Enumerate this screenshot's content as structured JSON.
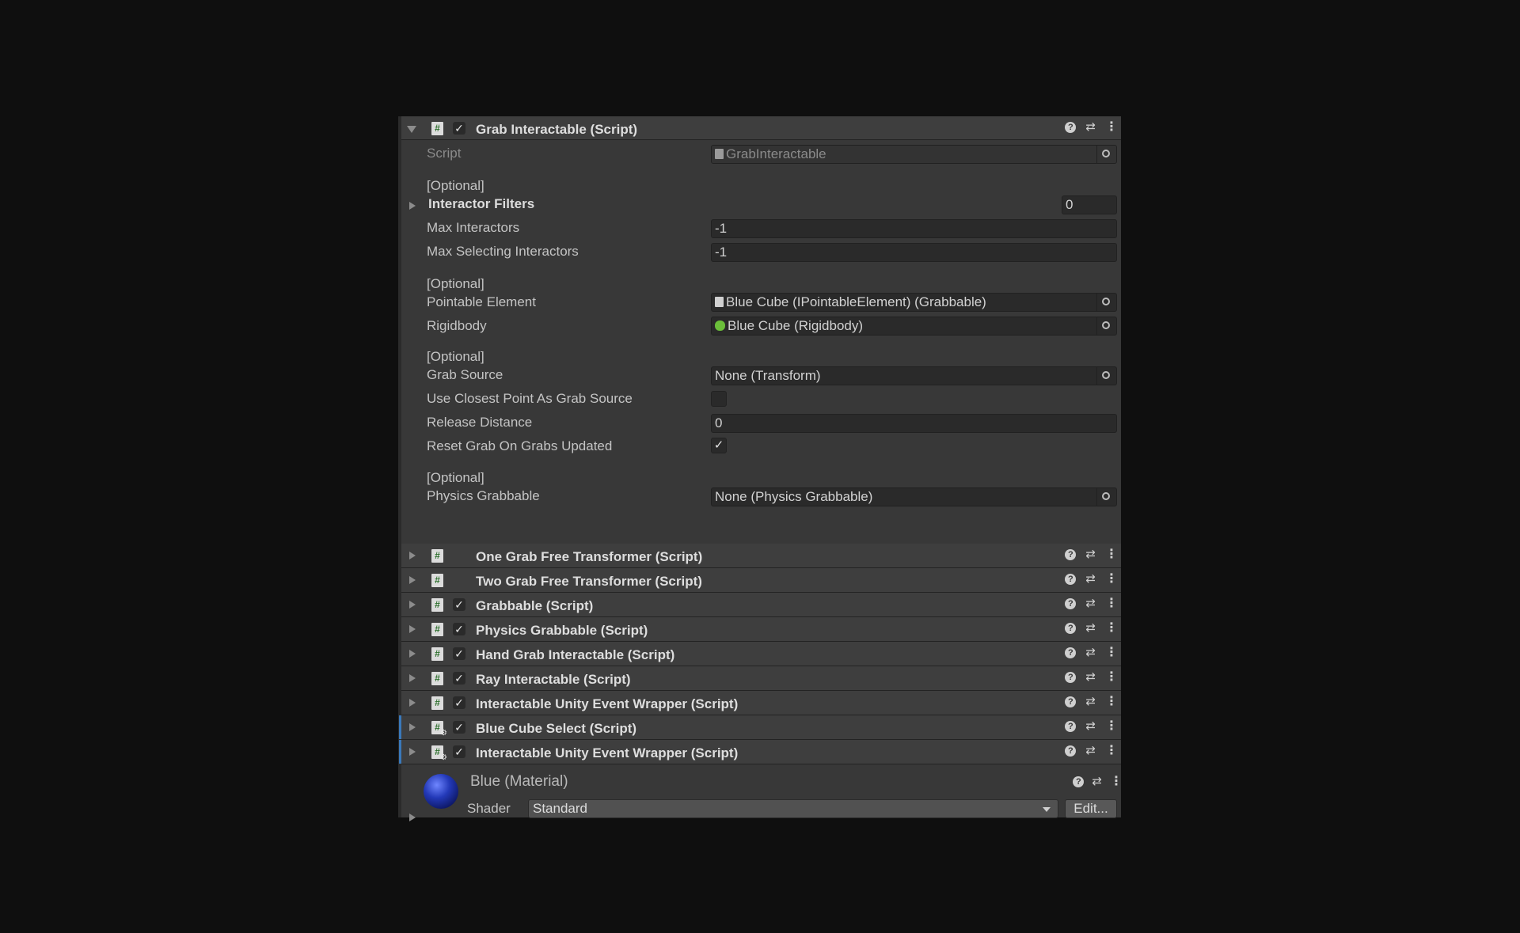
{
  "main_component": {
    "title": "Grab Interactable (Script)",
    "enabled": "✓",
    "fields": {
      "script_label": "Script",
      "script_value": "GrabInteractable",
      "optional_1": "[Optional]",
      "interactor_filters_label": "Interactor Filters",
      "interactor_filters_count": "0",
      "max_interactors_label": "Max Interactors",
      "max_interactors_value": "-1",
      "max_selecting_label": "Max Selecting Interactors",
      "max_selecting_value": "-1",
      "optional_2": "[Optional]",
      "pointable_element_label": "Pointable Element",
      "pointable_element_value": "Blue Cube (IPointableElement) (Grabbable)",
      "rigidbody_label": "Rigidbody",
      "rigidbody_value": "Blue Cube (Rigidbody)",
      "optional_3": "[Optional]",
      "grab_source_label": "Grab Source",
      "grab_source_value": "None (Transform)",
      "use_closest_label": "Use Closest Point As Grab Source",
      "release_distance_label": "Release Distance",
      "release_distance_value": "0",
      "reset_grab_label": "Reset Grab On Grabs Updated",
      "reset_grab_check": "✓",
      "optional_4": "[Optional]",
      "physics_grabbable_label": "Physics Grabbable",
      "physics_grabbable_value": "None (Physics Grabbable)"
    }
  },
  "components": [
    {
      "title": "One Grab Free Transformer (Script)",
      "check": ""
    },
    {
      "title": "Two Grab Free Transformer (Script)",
      "check": ""
    },
    {
      "title": "Grabbable (Script)",
      "check": "✓"
    },
    {
      "title": "Physics Grabbable (Script)",
      "check": "✓"
    },
    {
      "title": "Hand Grab Interactable (Script)",
      "check": "✓"
    },
    {
      "title": "Ray Interactable (Script)",
      "check": "✓"
    },
    {
      "title": "Interactable Unity Event Wrapper (Script)",
      "check": "✓"
    },
    {
      "title": "Blue Cube Select (Script)",
      "check": "✓"
    },
    {
      "title": "Interactable Unity Event Wrapper (Script)",
      "check": "✓"
    }
  ],
  "material": {
    "name": "Blue (Material)",
    "shader_label": "Shader",
    "shader_value": "Standard",
    "edit_label": "Edit..."
  },
  "icons": {
    "script": "#",
    "help": "?",
    "presets": "⇄",
    "menu": "⋮"
  }
}
